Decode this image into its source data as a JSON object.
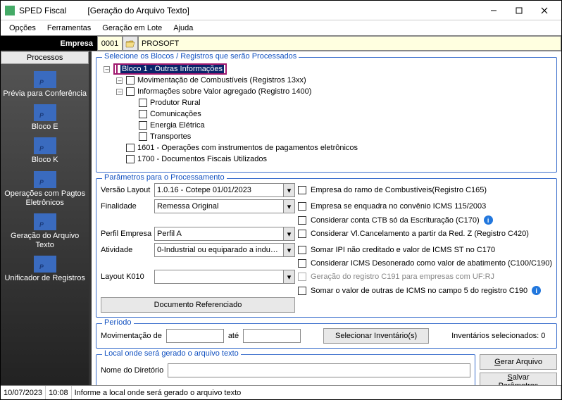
{
  "window": {
    "title": "SPED Fiscal",
    "subtitle": "[Geração do Arquivo Texto]"
  },
  "menus": {
    "opcoes": "Opções",
    "ferramentas": "Ferramentas",
    "lote": "Geração em Lote",
    "ajuda": "Ajuda"
  },
  "empresa": {
    "label": "Empresa",
    "code": "0001",
    "name": "PROSOFT"
  },
  "sidebar": {
    "header": "Processos",
    "items": [
      {
        "label": "Prévia para Conferência"
      },
      {
        "label": "Bloco E"
      },
      {
        "label": "Bloco K"
      },
      {
        "label": "Operações com Pagtos Eletrônicos"
      },
      {
        "label": "Geração do Arquivo Texto"
      },
      {
        "label": "Unificador de Registros"
      }
    ]
  },
  "blocos": {
    "legend": "Selecione os Blocos / Registros que serão Processados",
    "root": "Bloco 1 - Outras Informações",
    "n1": "Movimentação de Combustíveis (Registros 13xx)",
    "n2": "Informações sobre Valor agregado (Registro 1400)",
    "n2a": "Produtor Rural",
    "n2b": "Comunicações",
    "n2c": "Energia Elétrica",
    "n2d": "Transportes",
    "n3": "1601 - Operações com instrumentos de pagamentos eletrônicos",
    "n4": "1700 - Documentos Fiscais Utilizados"
  },
  "params": {
    "legend": "Parâmetros para o Processamento",
    "versao_label": "Versão Layout",
    "versao": "1.0.16 - Cotepe 01/01/2023",
    "finalidade_label": "Finalidade",
    "finalidade": "Remessa Original",
    "perfil_label": "Perfil Empresa",
    "perfil": "Perfil A",
    "atividade_label": "Atividade",
    "atividade": "0-Industrial ou equiparado a industrial",
    "k010_label": "Layout K010",
    "k010": "",
    "docref": "Documento Referenciado",
    "checks": {
      "c1": "Empresa do ramo de Combustíveis(Registro C165)",
      "c2": "Empresa se enquadra no convênio ICMS 115/2003",
      "c3": "Considerar conta CTB só da Escrituração (C170)",
      "c4": "Considerar Vl.Cancelamento a partir da Red. Z (Registro C420)",
      "c5": "Somar IPI não creditado e valor de ICMS ST no C170",
      "c6": "Considerar ICMS Desonerado como valor de abatimento (C100/C190)",
      "c7": "Geração do registro C191 para empresas com UF:RJ",
      "c8": "Somar o valor de outras de ICMS no campo 5 do registro C190"
    }
  },
  "periodo": {
    "legend": "Período",
    "mov_label": "Movimentação de",
    "ate": "até",
    "sel_inv": "Selecionar Inventário(s)",
    "inv_sel": "Inventários selecionados:  0"
  },
  "local": {
    "legend": "Local onde será gerado o arquivo texto",
    "nome_label": "Nome do Diretório"
  },
  "buttons": {
    "gerar_pre": "G",
    "gerar": "erar Arquivo",
    "salvar_pre": "S",
    "salvar": "alvar Parâmetros"
  },
  "status": {
    "date": "10/07/2023",
    "time": "10:08",
    "msg": "Informe a local onde será gerado o arquivo texto"
  }
}
